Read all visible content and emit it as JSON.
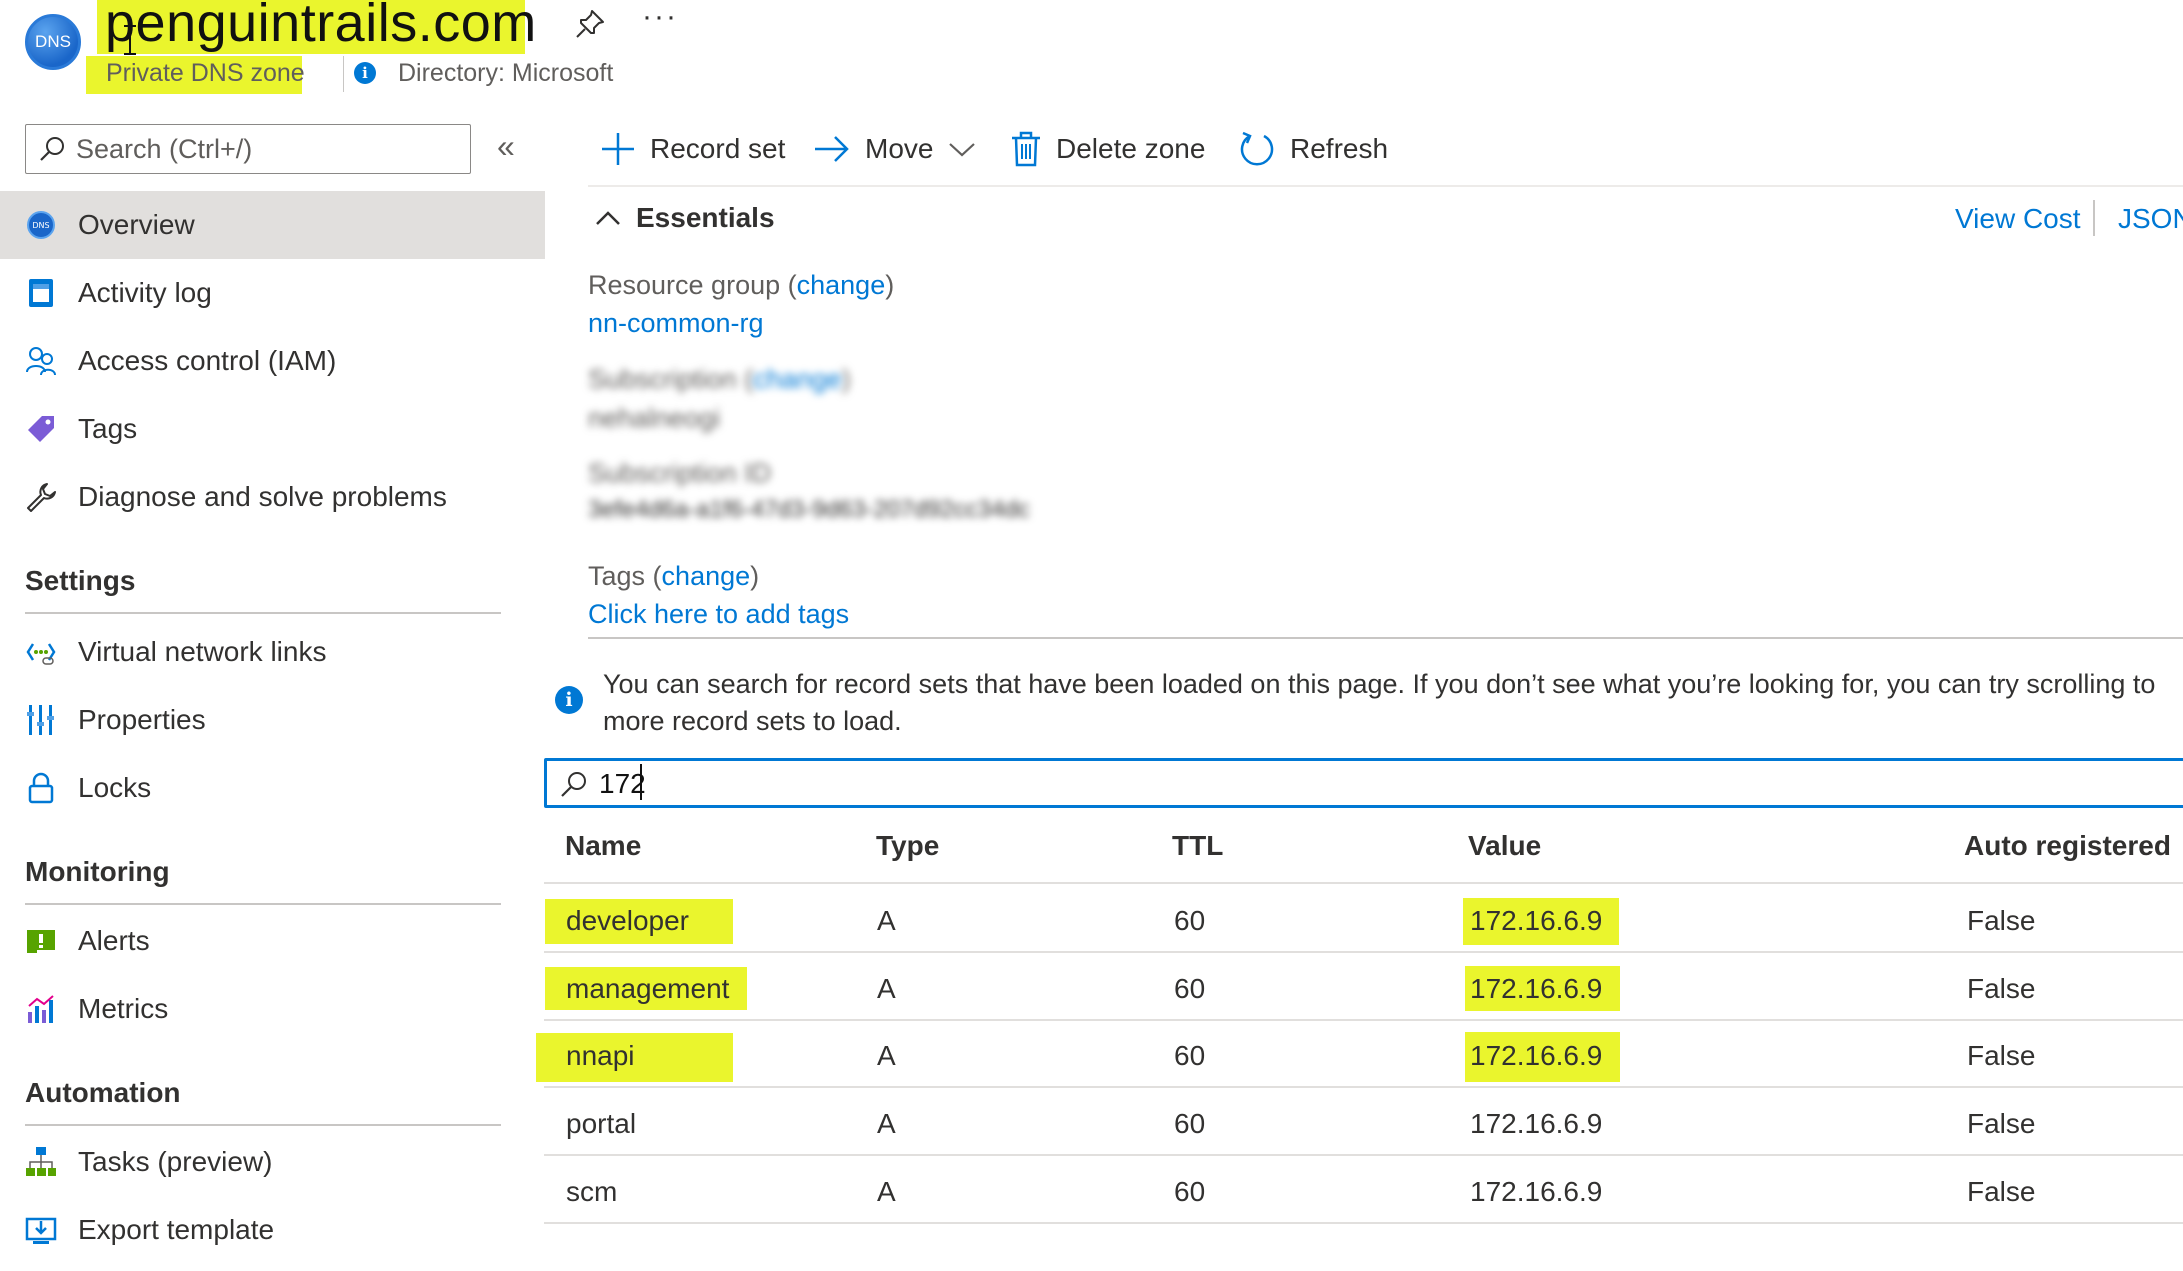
{
  "header": {
    "logo_text": "DNS",
    "title": "penguintrails.com",
    "subtitle": "Private DNS zone",
    "directory": "Directory: Microsoft",
    "more": "···"
  },
  "sidebar": {
    "search_placeholder": "Search (Ctrl+/)",
    "collapse": "«",
    "items": [
      {
        "label": "Overview",
        "icon": "dns-zone-icon",
        "active": true
      },
      {
        "label": "Activity log",
        "icon": "activity-log-icon"
      },
      {
        "label": "Access control (IAM)",
        "icon": "people-icon"
      },
      {
        "label": "Tags",
        "icon": "tag-icon"
      },
      {
        "label": "Diagnose and solve problems",
        "icon": "wrench-icon"
      }
    ],
    "sections": [
      {
        "title": "Settings",
        "items": [
          {
            "label": "Virtual network links",
            "icon": "network-link-icon"
          },
          {
            "label": "Properties",
            "icon": "properties-icon"
          },
          {
            "label": "Locks",
            "icon": "lock-icon"
          }
        ]
      },
      {
        "title": "Monitoring",
        "items": [
          {
            "label": "Alerts",
            "icon": "alert-icon"
          },
          {
            "label": "Metrics",
            "icon": "metrics-icon"
          }
        ]
      },
      {
        "title": "Automation",
        "items": [
          {
            "label": "Tasks (preview)",
            "icon": "tasks-icon"
          },
          {
            "label": "Export template",
            "icon": "export-template-icon"
          }
        ]
      }
    ]
  },
  "toolbar": {
    "record_set": "Record set",
    "move": "Move",
    "delete_zone": "Delete zone",
    "refresh": "Refresh"
  },
  "essentials": {
    "title": "Essentials",
    "view_cost": "View Cost",
    "json_view": "JSON View",
    "resource_group_label": "Resource group",
    "change": "change",
    "resource_group_value": "nn-common-rg",
    "subscription_label": "Subscription",
    "subscription_value": "nehalneogi",
    "subscription_id_label": "Subscription ID",
    "subscription_id_value": "3efe4d6a-a1f6-47d3-9d63-207d92cc34dc",
    "tags_label": "Tags",
    "tags_value": "Click here to add tags"
  },
  "info_message": {
    "line1": "You can search for record sets that have been loaded on this page. If you don’t see what you’re looking for, you can try scrolling to",
    "line2": "more record sets to load."
  },
  "record_filter": {
    "value": "172"
  },
  "table": {
    "headers": [
      "Name",
      "Type",
      "TTL",
      "Value",
      "Auto registered"
    ],
    "rows": [
      {
        "name": "developer",
        "type": "A",
        "ttl": "60",
        "value": "172.16.6.9",
        "auto": "False",
        "highlighted": true
      },
      {
        "name": "management",
        "type": "A",
        "ttl": "60",
        "value": "172.16.6.9",
        "auto": "False",
        "highlighted": true
      },
      {
        "name": "nnapi",
        "type": "A",
        "ttl": "60",
        "value": "172.16.6.9",
        "auto": "False",
        "highlighted": true
      },
      {
        "name": "portal",
        "type": "A",
        "ttl": "60",
        "value": "172.16.6.9",
        "auto": "False",
        "highlighted": false
      },
      {
        "name": "scm",
        "type": "A",
        "ttl": "60",
        "value": "172.16.6.9",
        "auto": "False",
        "highlighted": false
      }
    ]
  },
  "colors": {
    "accent": "#0078d4",
    "highlight": "#eaf52d",
    "active_nav": "#e1dfdd"
  }
}
